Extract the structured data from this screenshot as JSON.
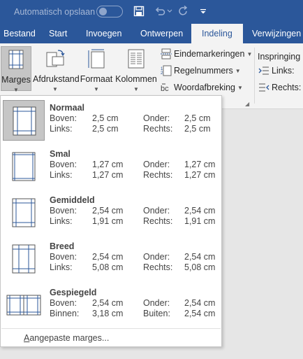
{
  "titlebar": {
    "autosave_label": "Automatisch opslaan",
    "icons": [
      "save-icon",
      "undo-icon",
      "redo-icon",
      "customize-qat-icon"
    ]
  },
  "tabs": [
    {
      "label": "Bestand",
      "active": false
    },
    {
      "label": "Start",
      "active": false
    },
    {
      "label": "Invoegen",
      "active": false
    },
    {
      "label": "Ontwerpen",
      "active": false
    },
    {
      "label": "Indeling",
      "active": true
    },
    {
      "label": "Verwijzingen",
      "active": false
    }
  ],
  "ribbon": {
    "marges": "Marges",
    "afdrukstand": "Afdrukstand",
    "formaat": "Formaat",
    "kolommen": "Kolommen",
    "eindemarkeringen": "Eindemarkeringen",
    "regelnummers": "Regelnummers",
    "woordafbreking": "Woordafbreking",
    "inspringing": "Inspringing",
    "links": "Links:",
    "rechts": "Rechts:"
  },
  "margins_menu": {
    "items": [
      {
        "name": "Normaal",
        "l1": "Boven:",
        "v1": "2,5 cm",
        "l2": "Onder:",
        "v2": "2,5 cm",
        "l3": "Links:",
        "v3": "2,5 cm",
        "l4": "Rechts:",
        "v4": "2,5 cm",
        "selected": true
      },
      {
        "name": "Smal",
        "l1": "Boven:",
        "v1": "1,27 cm",
        "l2": "Onder:",
        "v2": "1,27 cm",
        "l3": "Links:",
        "v3": "1,27 cm",
        "l4": "Rechts:",
        "v4": "1,27 cm",
        "selected": false
      },
      {
        "name": "Gemiddeld",
        "l1": "Boven:",
        "v1": "2,54 cm",
        "l2": "Onder:",
        "v2": "2,54 cm",
        "l3": "Links:",
        "v3": "1,91 cm",
        "l4": "Rechts:",
        "v4": "1,91 cm",
        "selected": false
      },
      {
        "name": "Breed",
        "l1": "Boven:",
        "v1": "2,54 cm",
        "l2": "Onder:",
        "v2": "2,54 cm",
        "l3": "Links:",
        "v3": "5,08 cm",
        "l4": "Rechts:",
        "v4": "5,08 cm",
        "selected": false
      },
      {
        "name": "Gespiegeld",
        "l1": "Boven:",
        "v1": "2,54 cm",
        "l2": "Onder:",
        "v2": "2,54 cm",
        "l3": "Binnen:",
        "v3": "3,18 cm",
        "l4": "Buiten:",
        "v4": "2,54 cm",
        "selected": false
      }
    ],
    "custom_prefix": "A",
    "custom_rest": "angepaste marges..."
  },
  "colors": {
    "accent": "#2b579a",
    "ribbon": "#f3f3f3",
    "selected": "#c6c6c6"
  }
}
